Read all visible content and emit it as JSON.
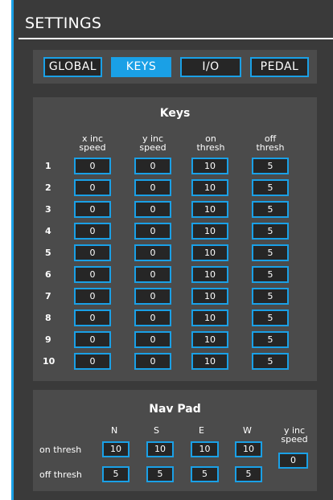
{
  "header": {
    "title": "SETTINGS"
  },
  "tabs": [
    {
      "label": "GLOBAL",
      "active": false
    },
    {
      "label": "KEYS",
      "active": true
    },
    {
      "label": "I/O",
      "active": false
    },
    {
      "label": "PEDAL",
      "active": false
    }
  ],
  "keys": {
    "title": "Keys",
    "columns": [
      {
        "line1": "x inc",
        "line2": "speed"
      },
      {
        "line1": "y inc",
        "line2": "speed"
      },
      {
        "line1": "on",
        "line2": "thresh"
      },
      {
        "line1": "off",
        "line2": "thresh"
      }
    ],
    "rows": [
      {
        "label": "1",
        "values": [
          "0",
          "0",
          "10",
          "5"
        ]
      },
      {
        "label": "2",
        "values": [
          "0",
          "0",
          "10",
          "5"
        ]
      },
      {
        "label": "3",
        "values": [
          "0",
          "0",
          "10",
          "5"
        ]
      },
      {
        "label": "4",
        "values": [
          "0",
          "0",
          "10",
          "5"
        ]
      },
      {
        "label": "5",
        "values": [
          "0",
          "0",
          "10",
          "5"
        ]
      },
      {
        "label": "6",
        "values": [
          "0",
          "0",
          "10",
          "5"
        ]
      },
      {
        "label": "7",
        "values": [
          "0",
          "0",
          "10",
          "5"
        ]
      },
      {
        "label": "8",
        "values": [
          "0",
          "0",
          "10",
          "5"
        ]
      },
      {
        "label": "9",
        "values": [
          "0",
          "0",
          "10",
          "5"
        ]
      },
      {
        "label": "10",
        "values": [
          "0",
          "0",
          "10",
          "5"
        ]
      }
    ]
  },
  "navpad": {
    "title": "Nav Pad",
    "directions": [
      "N",
      "S",
      "E",
      "W"
    ],
    "y_inc_speed": {
      "line1": "y inc",
      "line2": "speed",
      "value": "0"
    },
    "rows": [
      {
        "label": "on thresh",
        "values": [
          "10",
          "10",
          "10",
          "10"
        ]
      },
      {
        "label": "off thresh",
        "values": [
          "5",
          "5",
          "5",
          "5"
        ]
      }
    ]
  },
  "colors": {
    "accent": "#1aa0e6",
    "panel": "#3a3a3a",
    "section": "#4b4b4b",
    "field": "#262626"
  }
}
